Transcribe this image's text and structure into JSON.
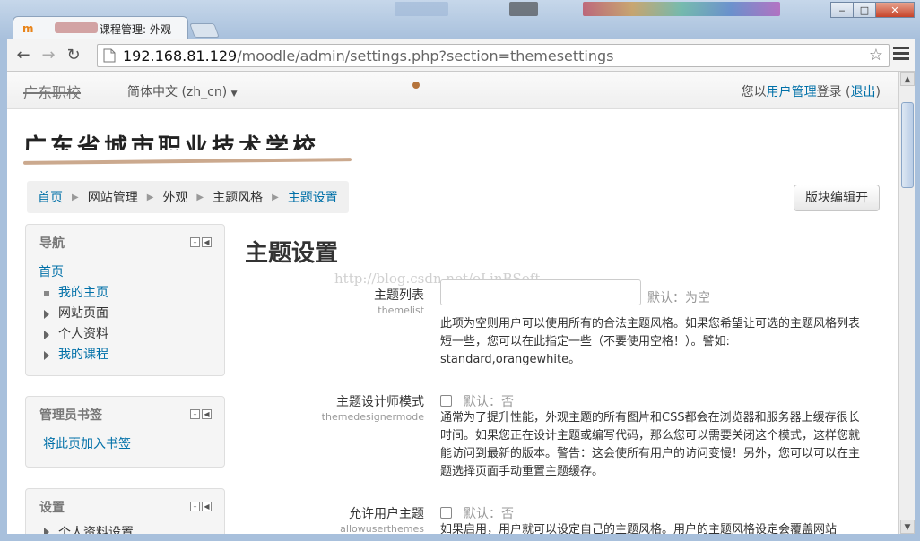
{
  "browser": {
    "tab_title": "课程管理: 外观",
    "url_host": "192.168.81.129",
    "url_path": "/moodle/admin/settings.php?section=themesettings",
    "window_buttons": [
      "‒",
      "□",
      "✕"
    ]
  },
  "navbar": {
    "brand": "广东职校",
    "language": "简体中文 (zh_cn)",
    "login_prefix": "您以",
    "login_user": "用户管理",
    "login_mid": "登录 (",
    "logout": "退出",
    "login_suffix": ")"
  },
  "site": {
    "name": "广东省城市职业技术学校"
  },
  "breadcrumb": {
    "items": [
      "首页",
      "网站管理",
      "外观",
      "主题风格",
      "主题设置"
    ],
    "separator": "▶"
  },
  "edit_button": "版块编辑开",
  "blocks": {
    "navigation": {
      "title": "导航",
      "home": "首页",
      "items": [
        {
          "label": "我的主页",
          "type": "bullet"
        },
        {
          "label": "网站页面",
          "type": "arrow"
        },
        {
          "label": "个人资料",
          "type": "arrow"
        },
        {
          "label": "我的课程",
          "type": "arrow"
        }
      ]
    },
    "bookmarks": {
      "title": "管理员书签",
      "link": "将此页加入书签"
    },
    "settings": {
      "title": "设置",
      "first_item": "个人资料设置"
    }
  },
  "main": {
    "title": "主题设置",
    "watermark": "http://blog.csdn.net/oLinBSoft",
    "settings": [
      {
        "label": "主题列表",
        "key": "themelist",
        "default": "默认：为空",
        "desc": "此项为空则用户可以使用所有的合法主题风格。如果您希望让可选的主题风格列表短一些，您可以在此指定一些（不要使用空格！）。譬如: standard,orangewhite。"
      },
      {
        "label": "主题设计师模式",
        "key": "themedesignermode",
        "default": "默认：否",
        "desc": "通常为了提升性能，外观主题的所有图片和CSS都会在浏览器和服务器上缓存很长时间。如果您正在设计主题或编写代码，那么您可以需要关闭这个模式，这样您就能访问到最新的版本。警告：这会使所有用户的访问变慢！另外，您可以可以在主题选择页面手动重置主题缓存。"
      },
      {
        "label": "允许用户主题",
        "key": "allowuserthemes",
        "default": "默认：否",
        "desc": "如果启用，用户就可以设定自己的主题风格。用户的主题风格设定会覆盖网站"
      }
    ]
  }
}
